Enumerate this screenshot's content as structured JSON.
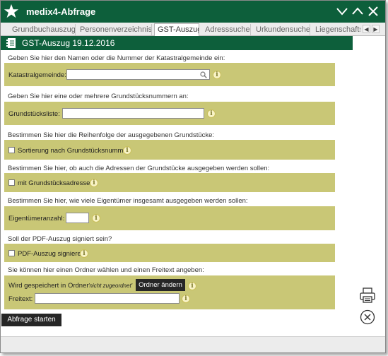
{
  "app": {
    "title": "medix4-Abfrage"
  },
  "tabs": [
    {
      "label": "Grundbuchauszug",
      "active": false
    },
    {
      "label": "Personenverzeichnis",
      "active": false
    },
    {
      "label": "GST-Auszug",
      "active": true
    },
    {
      "label": "Adresssuche",
      "active": false
    },
    {
      "label": "Urkundensuche",
      "active": false
    },
    {
      "label": "Liegenschaftsa",
      "active": false
    }
  ],
  "section": {
    "title": "GST-Auszug 19.12.2016"
  },
  "form": {
    "katastral": {
      "prompt": "Geben Sie hier den Namen oder die Nummer der Katastralgemeinde ein:",
      "label": "Katastralgemeinde:",
      "value": ""
    },
    "grundstuecke": {
      "prompt": "Geben Sie hier eine oder mehrere Grundstücksnummern an:",
      "label": "Grundstücksliste:",
      "value": ""
    },
    "sortierung": {
      "prompt": "Bestimmen Sie hier die Reihenfolge der ausgegebenen Grundstücke:",
      "label": "Sortierung nach Grundstücksnummer",
      "checked": false
    },
    "adressen": {
      "prompt": "Bestimmen Sie hier, ob auch die Adressen der Grundstücke ausgegeben werden sollen:",
      "label": "mit Grundstücksadressen",
      "checked": false
    },
    "eigentuemer": {
      "prompt": "Bestimmen Sie hier, wie viele Eigentümer insgesamt ausgegeben werden sollen:",
      "label": "Eigentümeranzahl:",
      "value": ""
    },
    "pdf": {
      "prompt": "Soll der PDF-Auszug signiert sein?",
      "label": "PDF-Auszug signieren",
      "checked": false
    },
    "ordner": {
      "prompt": "Sie können hier einen Ordner wählen und einen Freitext angeben:",
      "label": "Wird gespeichert in Ordner",
      "status": "'nicht zugeordnet'",
      "button": "Ordner ändern",
      "freitext_label": "Freitext:",
      "freitext_value": ""
    }
  },
  "actions": {
    "submit": "Abfrage starten"
  },
  "info_glyph": "i",
  "tab_nav": {
    "prev": "◀",
    "next": "▶"
  },
  "colors": {
    "titlebar": "#0d5f3b",
    "band": "#c9c776",
    "button": "#262626"
  }
}
